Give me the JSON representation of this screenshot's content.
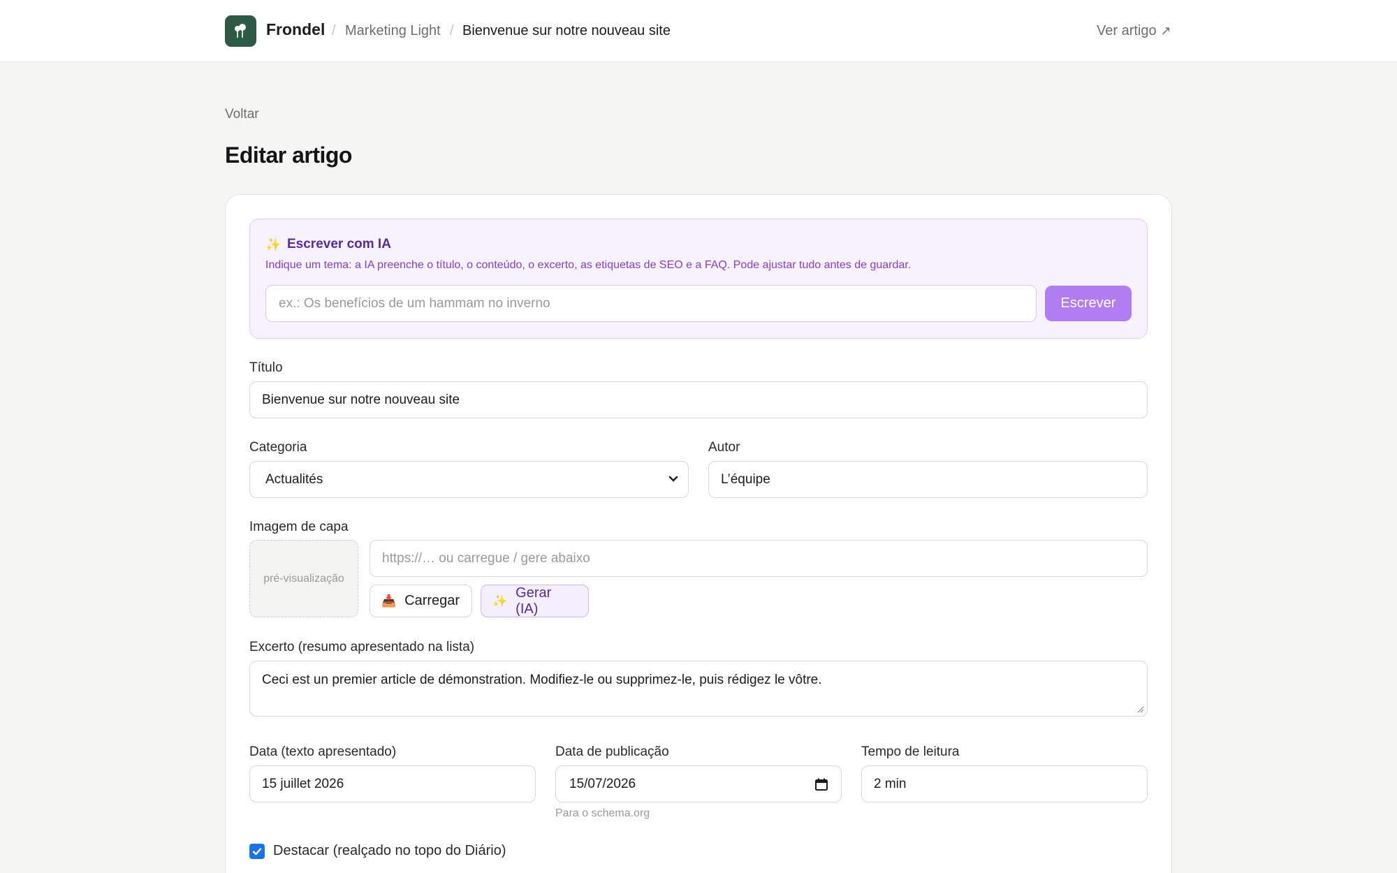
{
  "header": {
    "brand": "Frondel",
    "breadcrumb": [
      "Marketing Light",
      "Bienvenue sur notre nouveau site"
    ],
    "view_link": "Ver artigo",
    "view_link_icon": "external-arrow-icon",
    "logo_icon": "tree-icon"
  },
  "page": {
    "back": "Voltar",
    "title": "Editar artigo"
  },
  "ai": {
    "icon": "sparkle-icon",
    "title": "Escrever com IA",
    "description": "Indique um tema: a IA preenche o título, o conteúdo, o excerto, as etiquetas de SEO e a FAQ. Pode ajustar tudo antes de guardar.",
    "placeholder": "ex.: Os benefícios de um hammam no inverno",
    "value": "",
    "button": "Escrever"
  },
  "form": {
    "title_label": "Título",
    "title_value": "Bienvenue sur notre nouveau site",
    "category_label": "Categoria",
    "category_value": "Actualités",
    "author_label": "Autor",
    "author_value": "L’équipe",
    "cover_label": "Imagem de capa",
    "cover_preview": "pré-visualização",
    "cover_placeholder": "https://… ou carregue / gere abaixo",
    "upload_button": "Carregar",
    "upload_icon": "inbox-tray-icon",
    "generate_button": "Gerar (IA)",
    "generate_icon": "sparkle-icon",
    "excerpt_label": "Excerto (resumo apresentado na lista)",
    "excerpt_value": "Ceci est un premier article de démonstration. Modifiez-le ou supprimez-le, puis rédigez le vôtre.",
    "date_text_label": "Data (texto apresentado)",
    "date_text_value": "15 juillet 2026",
    "publish_date_label": "Data de publicação",
    "publish_date_value": "15/07/2026",
    "publish_date_hint": "Para o schema.org",
    "reading_time_label": "Tempo de leitura",
    "reading_time_value": "2 min",
    "featured_label": "Destacar (realçado no topo do Diário)",
    "featured_checked": true
  },
  "colors": {
    "brand": "#2c5a44",
    "ai_accent": "#b07ef0",
    "checkbox": "#1a73e8"
  }
}
